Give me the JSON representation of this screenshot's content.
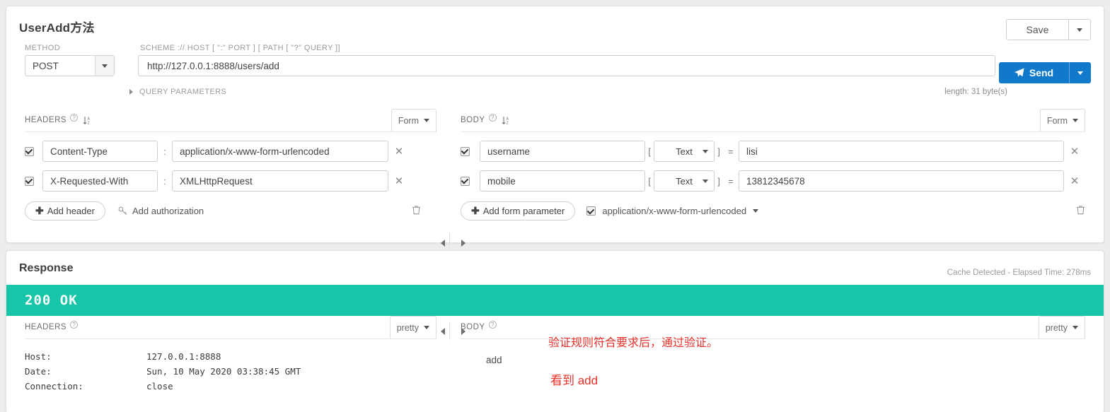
{
  "request": {
    "title": "UserAdd方法",
    "save_label": "Save",
    "send_label": "Send",
    "length_note": "length: 31 byte(s)",
    "method_label": "METHOD",
    "method_value": "POST",
    "url_label": "SCHEME :// HOST [ \":\" PORT ] [ PATH [ \"?\" QUERY ]]",
    "url_value": "http://127.0.0.1:8888/users/add",
    "query_params_label": "QUERY PARAMETERS",
    "headers": {
      "title": "HEADERS",
      "mode": "Form",
      "rows": [
        {
          "key": "Content-Type",
          "value": "application/x-www-form-urlencoded",
          "checked": true
        },
        {
          "key": "X-Requested-With",
          "value": "XMLHttpRequest",
          "checked": true
        }
      ],
      "add_label": "Add header",
      "add_auth_label": "Add authorization"
    },
    "body": {
      "title": "BODY",
      "mode": "Form",
      "rows": [
        {
          "key": "username",
          "type": "Text",
          "value": "lisi",
          "checked": true
        },
        {
          "key": "mobile",
          "type": "Text",
          "value": "13812345678",
          "checked": true
        }
      ],
      "add_label": "Add form parameter",
      "content_type": "application/x-www-form-urlencoded"
    }
  },
  "response": {
    "title": "Response",
    "cache_note": "Cache Detected - Elapsed Time: 278ms",
    "status": "200 OK",
    "status_color": "#17c5a8",
    "headers": {
      "title": "HEADERS",
      "mode": "pretty",
      "rows": [
        {
          "key": "Host:",
          "value": "127.0.0.1:8888"
        },
        {
          "key": "Date:",
          "value": "Sun, 10 May 2020 03:38:45 GMT"
        },
        {
          "key": "Connection:",
          "value": "close"
        }
      ]
    },
    "body": {
      "title": "BODY",
      "mode": "pretty",
      "value": "add"
    }
  },
  "annotations": [
    {
      "text": "验证规则符合要求后，通过验证。",
      "color": "#e8312a"
    },
    {
      "text": "看到 add",
      "color": "#e8312a"
    }
  ],
  "symbols": {
    "colon": ":",
    "bracket_open": "[",
    "bracket_close": "]",
    "equals": "=",
    "close_x": "✕",
    "plus": "✚",
    "question": "?"
  }
}
